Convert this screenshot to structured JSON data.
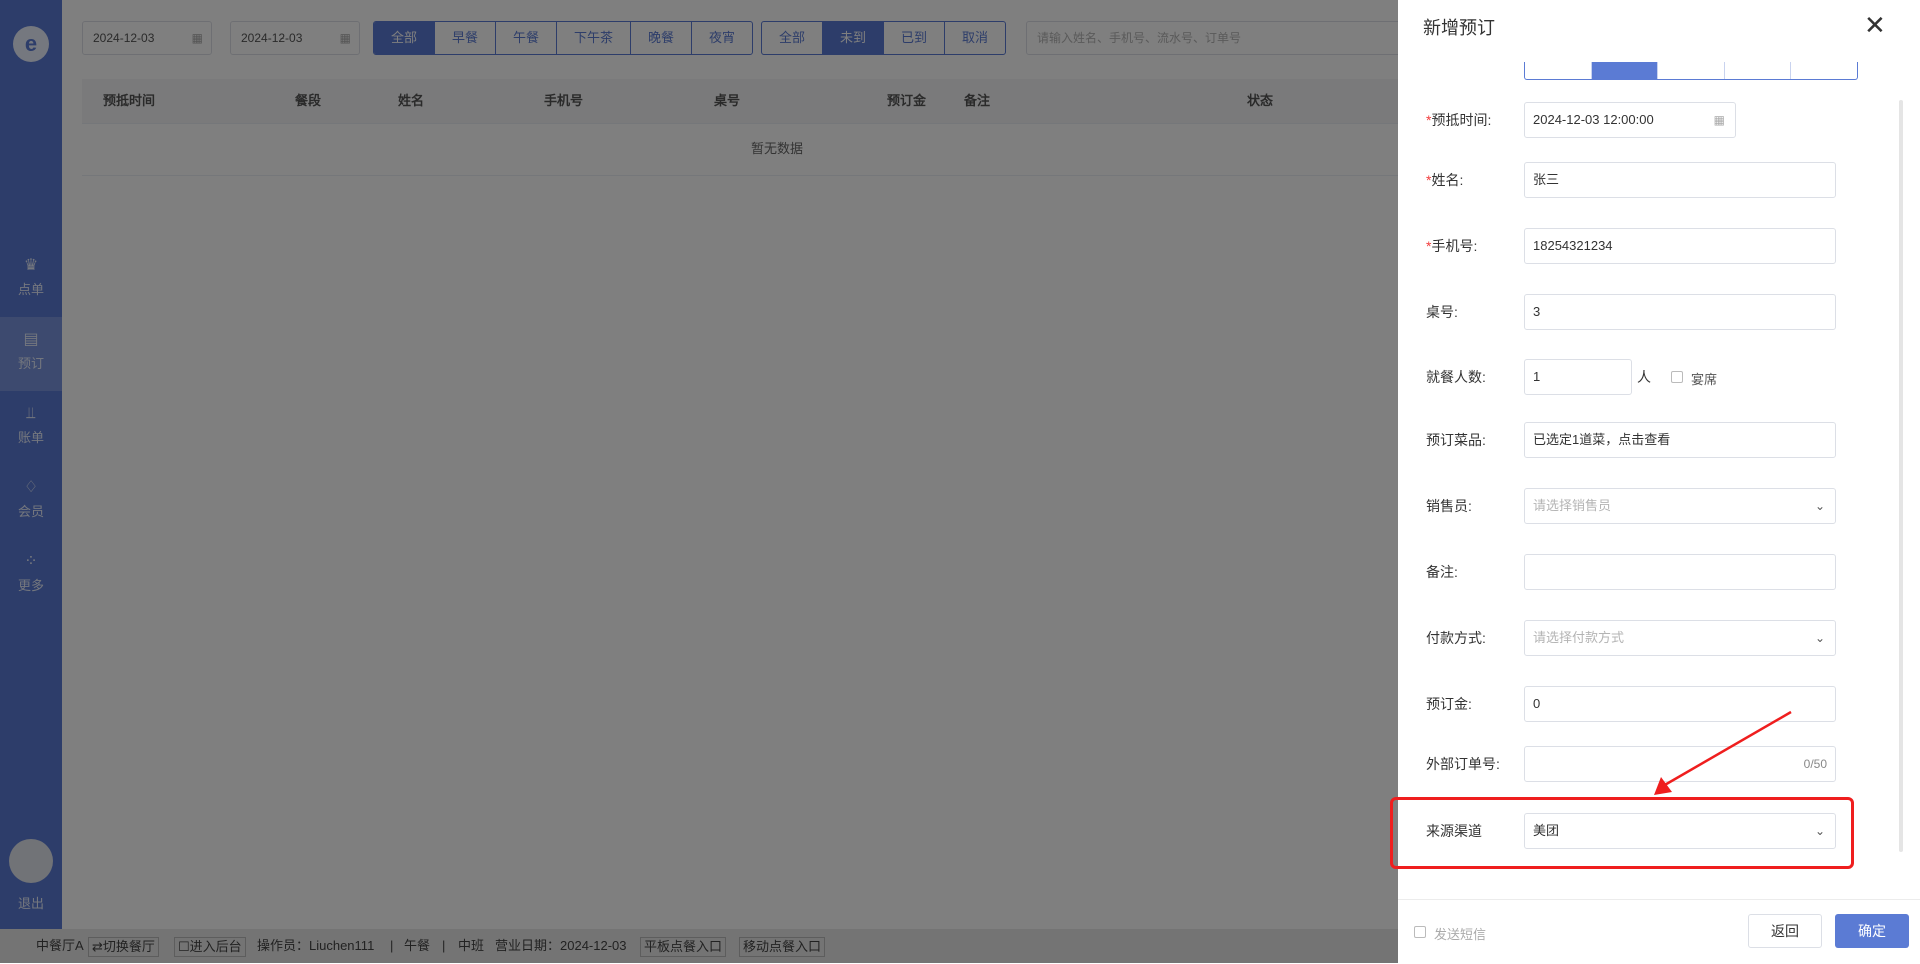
{
  "sidebar": {
    "logo": "e",
    "items": [
      {
        "label": "点单",
        "icon": "chef-hat-icon",
        "glyph": "♛"
      },
      {
        "label": "预订",
        "icon": "booking-icon",
        "glyph": "▤"
      },
      {
        "label": "账单",
        "icon": "chart-icon",
        "glyph": "⫫"
      },
      {
        "label": "会员",
        "icon": "diamond-icon",
        "glyph": "♢"
      },
      {
        "label": "更多",
        "icon": "grid-icon",
        "glyph": "⁘"
      }
    ],
    "logout": "退出"
  },
  "filters": {
    "date_start": "2024-12-03",
    "date_end": "2024-12-03",
    "date_sep": "-",
    "meals": [
      "全部",
      "早餐",
      "午餐",
      "下午茶",
      "晚餐",
      "夜宵"
    ],
    "meal_active": "全部",
    "status": [
      "全部",
      "未到",
      "已到",
      "取消"
    ],
    "status_active": "未到",
    "search_placeholder": "请输入姓名、手机号、流水号、订单号"
  },
  "table": {
    "headers": [
      "预抵时间",
      "餐段",
      "姓名",
      "手机号",
      "桌号",
      "预订金",
      "备注",
      "状态"
    ],
    "empty": "暂无数据"
  },
  "footer": {
    "hall": "中餐厅A",
    "switch_hall": "⇄切换餐厅",
    "backend": "☐进入后台",
    "operator": "操作员：Liuchen111",
    "sep": "|",
    "meal": "午餐",
    "shift": "中班",
    "biz_date": "营业日期：2024-12-03",
    "tablet_entry": "平板点餐入口",
    "mobile_entry": "移动点餐入口"
  },
  "drawer": {
    "title": "新增预订",
    "fields": {
      "arrival_time": {
        "label": "预抵时间:",
        "value": "2024-12-03 12:00:00",
        "required": "*"
      },
      "name": {
        "label": "姓名:",
        "value": "张三",
        "required": "*"
      },
      "phone": {
        "label": "手机号:",
        "value": "18254321234",
        "required": "*"
      },
      "table_no": {
        "label": "桌号:",
        "value": "3"
      },
      "guests": {
        "label": "就餐人数:",
        "value": "1",
        "unit": "人",
        "banquet": "宴席"
      },
      "dishes": {
        "label": "预订菜品:",
        "value": "已选定1道菜，点击查看"
      },
      "salesperson": {
        "label": "销售员:",
        "placeholder": "请选择销售员"
      },
      "remark": {
        "label": "备注:",
        "value": ""
      },
      "payment": {
        "label": "付款方式:",
        "placeholder": "请选择付款方式"
      },
      "deposit": {
        "label": "预订金:",
        "value": "0"
      },
      "external_order": {
        "label": "外部订单号:",
        "value": "",
        "counter": "0/50"
      },
      "source": {
        "label": "来源渠道",
        "value": "美团"
      }
    },
    "sms": "发送短信",
    "back": "返回",
    "confirm": "确定"
  },
  "colors": {
    "primary": "#5b7bd4",
    "highlight": "#ef1e1e"
  }
}
